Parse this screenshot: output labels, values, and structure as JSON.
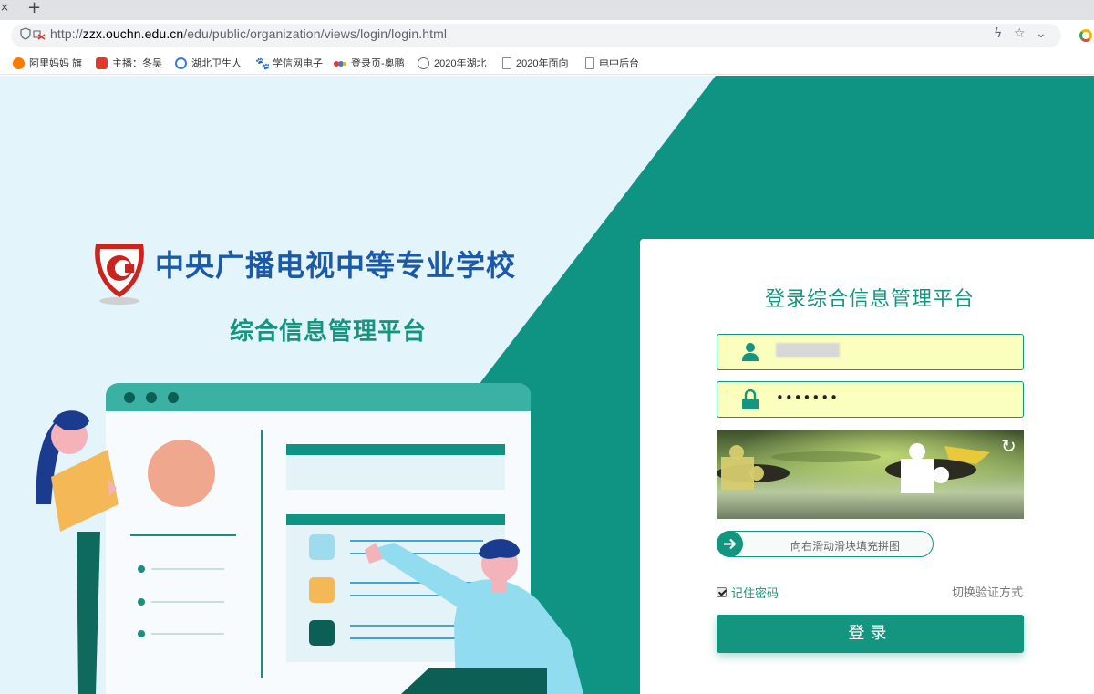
{
  "browser": {
    "tab_close": "×",
    "new_tab": "+",
    "url_prefix": "http://",
    "url_host": "zzx.ouchn.edu.cn",
    "url_path": "/edu/public/organization/views/login/login.html",
    "bookmarks": [
      {
        "label": "阿里妈妈 旗",
        "icon": "alimama-icon",
        "color": "#ff7a00"
      },
      {
        "label": "主播：冬吴",
        "icon": "ting-icon",
        "color": "#e03a2c"
      },
      {
        "label": "湖北卫生人",
        "icon": "hubei-health-icon",
        "color": "#3a7bd5"
      },
      {
        "label": "学信网电子",
        "icon": "paw-icon",
        "color": "#2f6bd8"
      },
      {
        "label": "登录页-奥鹏",
        "icon": "aopeng-icon",
        "color": "#e33b3b"
      },
      {
        "label": "2020年湖北",
        "icon": "badge-icon",
        "color": "#666666"
      },
      {
        "label": "2020年面向",
        "icon": "page-icon",
        "color": "#888888"
      },
      {
        "label": "电中后台",
        "icon": "page-icon",
        "color": "#888888"
      }
    ]
  },
  "header": {
    "school_name": "中央广播电视中等专业学校",
    "platform_name": "综合信息管理平台"
  },
  "login": {
    "title": "登录综合信息管理平台",
    "username_value": "",
    "password_value": "•••••••",
    "slider_hint": "向右滑动滑块填充拼图",
    "remember_label": "记住密码",
    "remember_checked": true,
    "switch_verify": "切换验证方式",
    "submit_label": "登录"
  },
  "colors": {
    "brand_teal": "#149580",
    "brand_blue": "#1b5aa6",
    "bg_light": "#e4f4fb",
    "autofill": "#faffbd"
  }
}
